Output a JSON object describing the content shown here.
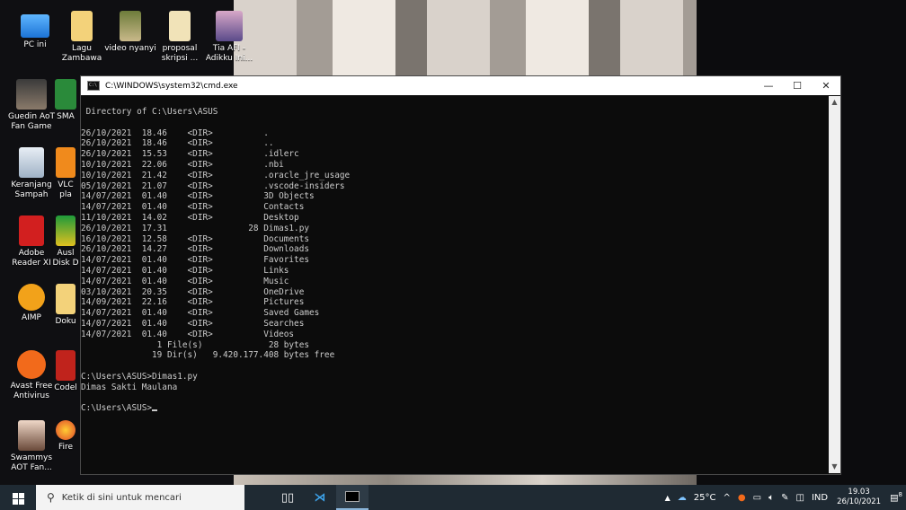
{
  "desktop": {
    "icons": [
      {
        "label": "PC ini",
        "icon": "pc-icon"
      },
      {
        "label": "Lagu Zambawa",
        "icon": "folder-icon"
      },
      {
        "label": "video nyanyi",
        "icon": "video-icon"
      },
      {
        "label": "proposal skripsi ...",
        "icon": "folder-icon"
      },
      {
        "label": "Tia AFI - Adikku Ini...",
        "icon": "video-icon"
      },
      {
        "label": "Guedin AoT Fan Game",
        "icon": "game-icon"
      },
      {
        "label": "SMA",
        "icon": "app-icon"
      },
      {
        "label": "Keranjang Sampah",
        "icon": "recycle-bin-icon"
      },
      {
        "label": "VLC pla",
        "icon": "vlc-icon"
      },
      {
        "label": "Adobe Reader XI",
        "icon": "adobe-reader-icon"
      },
      {
        "label": "Ausl Disk D",
        "icon": "app-icon"
      },
      {
        "label": "AIMP",
        "icon": "aimp-icon"
      },
      {
        "label": "Doku",
        "icon": "folder-icon"
      },
      {
        "label": "Avast Free Antivirus",
        "icon": "avast-icon"
      },
      {
        "label": "Codel",
        "icon": "app-icon"
      },
      {
        "label": "Swammys AOT Fan...",
        "icon": "game-icon"
      },
      {
        "label": "Fire",
        "icon": "firefox-icon"
      }
    ]
  },
  "cmd": {
    "title": "C:\\WINDOWS\\system32\\cmd.exe",
    "controls": {
      "minimize": "—",
      "maximize": "☐",
      "close": "✕"
    },
    "lines": [
      " Directory of C:\\Users\\ASUS",
      "",
      "26/10/2021  18.46    <DIR>          .",
      "26/10/2021  18.46    <DIR>          ..",
      "26/10/2021  15.53    <DIR>          .idlerc",
      "10/10/2021  22.06    <DIR>          .nbi",
      "10/10/2021  21.42    <DIR>          .oracle_jre_usage",
      "05/10/2021  21.07    <DIR>          .vscode-insiders",
      "14/07/2021  01.40    <DIR>          3D Objects",
      "14/07/2021  01.40    <DIR>          Contacts",
      "11/10/2021  14.02    <DIR>          Desktop",
      "26/10/2021  17.31                28 Dimas1.py",
      "16/10/2021  12.58    <DIR>          Documents",
      "26/10/2021  14.27    <DIR>          Downloads",
      "14/07/2021  01.40    <DIR>          Favorites",
      "14/07/2021  01.40    <DIR>          Links",
      "14/07/2021  01.40    <DIR>          Music",
      "03/10/2021  20.35    <DIR>          OneDrive",
      "14/09/2021  22.16    <DIR>          Pictures",
      "14/07/2021  01.40    <DIR>          Saved Games",
      "14/07/2021  01.40    <DIR>          Searches",
      "14/07/2021  01.40    <DIR>          Videos",
      "               1 File(s)             28 bytes",
      "              19 Dir(s)   9.420.177.408 bytes free",
      "",
      "C:\\Users\\ASUS>Dimas1.py",
      "Dimas Sakti Maulana",
      "",
      "C:\\Users\\ASUS>"
    ]
  },
  "taskbar": {
    "search_placeholder": "Ketik di sini untuk mencari",
    "weather": "25°C",
    "language": "IND",
    "time": "19.03",
    "date": "26/10/2021",
    "notification_count": "8"
  }
}
